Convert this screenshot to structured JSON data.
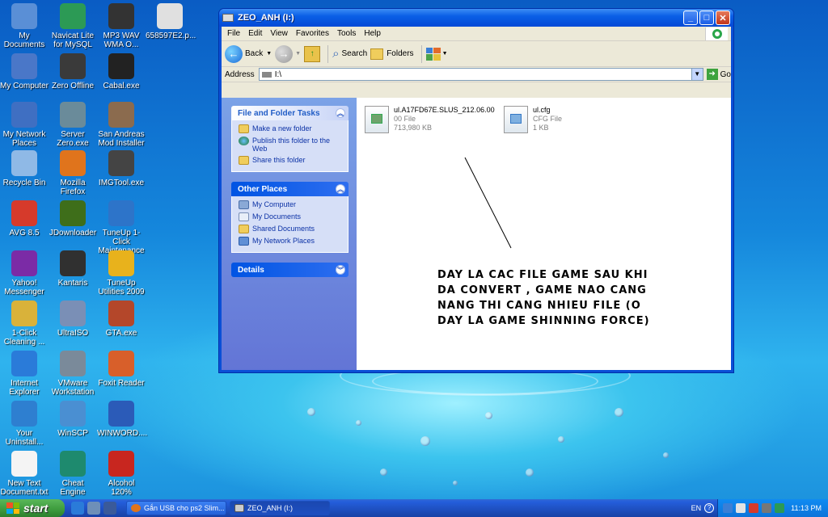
{
  "desktop": {
    "icons": [
      {
        "label": "My Documents",
        "icon": "folder-icon",
        "color": "#5a8fd6"
      },
      {
        "label": "Navicat Lite for MySQL",
        "icon": "navicat-icon",
        "color": "#2c9a55"
      },
      {
        "label": "MP3 WAV WMA O...",
        "icon": "audio-icon",
        "color": "#333333"
      },
      {
        "label": "658597E2.p...",
        "icon": "document-icon",
        "color": "#e0e0e0"
      },
      {
        "label": "My Computer",
        "icon": "computer-icon",
        "color": "#4a77c8"
      },
      {
        "label": "Zero Offline",
        "icon": "zero-icon",
        "color": "#3a3a3a"
      },
      {
        "label": "Cabal.exe",
        "icon": "cabal-icon",
        "color": "#222222"
      },
      {
        "label": "My Network Places",
        "icon": "network-icon",
        "color": "#3f6fc2"
      },
      {
        "label": "Server Zero.exe",
        "icon": "server-icon",
        "color": "#6a8b9a"
      },
      {
        "label": "San Andreas Mod Installer",
        "icon": "mod-installer-icon",
        "color": "#8b6b4e"
      },
      {
        "label": "Recycle Bin",
        "icon": "recycle-bin-icon",
        "color": "#8fb9e6"
      },
      {
        "label": "Mozilla Firefox",
        "icon": "firefox-icon",
        "color": "#e0741c"
      },
      {
        "label": "IMGTool.exe",
        "icon": "imgtool-icon",
        "color": "#444444"
      },
      {
        "label": "AVG 8.5",
        "icon": "avg-icon",
        "color": "#d63a2b"
      },
      {
        "label": "JDownloader",
        "icon": "jdownloader-icon",
        "color": "#3e6e1a"
      },
      {
        "label": "TuneUp 1-Click Maintenance",
        "icon": "tuneup-icon",
        "color": "#2d74c9"
      },
      {
        "label": "Yahoo! Messenger",
        "icon": "yahoo-icon",
        "color": "#7b2ba6"
      },
      {
        "label": "Kantaris",
        "icon": "kantaris-icon",
        "color": "#303030"
      },
      {
        "label": "TuneUp Utilities 2009",
        "icon": "tuneup-utilities-icon",
        "color": "#e8b21c"
      },
      {
        "label": "1-Click Cleaning ...",
        "icon": "cleaning-icon",
        "color": "#d9b23a"
      },
      {
        "label": "UltraISO",
        "icon": "ultraiso-icon",
        "color": "#7a8fb6"
      },
      {
        "label": "GTA.exe",
        "icon": "gta-icon",
        "color": "#b4472a"
      },
      {
        "label": "Internet Explorer",
        "icon": "internet-explorer-icon",
        "color": "#2a7bd9"
      },
      {
        "label": "VMware Workstation",
        "icon": "vmware-icon",
        "color": "#7a8a9a"
      },
      {
        "label": "Foxit Reader",
        "icon": "foxit-icon",
        "color": "#d85f2a"
      },
      {
        "label": "Your Uninstall...",
        "icon": "uninstall-icon",
        "color": "#2e7fd0"
      },
      {
        "label": "WinSCP",
        "icon": "winscp-icon",
        "color": "#4a8fd2"
      },
      {
        "label": "WINWORD....",
        "icon": "word-icon",
        "color": "#2b5bb8"
      },
      {
        "label": "New Text Document.txt",
        "icon": "text-file-icon",
        "color": "#f4f4f4"
      },
      {
        "label": "Cheat Engine",
        "icon": "cheat-engine-icon",
        "color": "#1e8a6e"
      },
      {
        "label": "Alcohol 120%",
        "icon": "alcohol-icon",
        "color": "#c8261f"
      }
    ]
  },
  "window": {
    "title": "ZEO_ANH (I:)",
    "menu": [
      "File",
      "Edit",
      "View",
      "Favorites",
      "Tools",
      "Help"
    ],
    "toolbar": {
      "back": "Back",
      "search": "Search",
      "folders": "Folders"
    },
    "address": {
      "label": "Address",
      "value": "I:\\",
      "go": "Go"
    },
    "tasks_panel": {
      "title": "File and Folder Tasks",
      "items": [
        "Make a new folder",
        "Publish this folder to the Web",
        "Share this folder"
      ]
    },
    "other_places": {
      "title": "Other Places",
      "items": [
        "My Computer",
        "My Documents",
        "Shared Documents",
        "My Network Places"
      ]
    },
    "details": {
      "title": "Details"
    },
    "files": [
      {
        "name": "ul.A17FD67E.SLUS_212.06.00",
        "type": "00 File",
        "size": "713,980 KB"
      },
      {
        "name": "ul.cfg",
        "type": "CFG File",
        "size": "1 KB"
      }
    ],
    "annotation": {
      "lines": [
        "DAY LA CAC FILE GAME SAU KHI",
        "DA CONVERT , GAME NAO CANG",
        "NANG THI CANG NHIEU FILE (O",
        "DAY LA GAME SHINNING FORCE)"
      ]
    }
  },
  "taskbar": {
    "start": "start",
    "buttons": [
      "Gắn USB cho ps2 Slim...",
      "ZEO_ANH (I:)"
    ],
    "lang": "EN",
    "clock": "11:13 PM"
  }
}
